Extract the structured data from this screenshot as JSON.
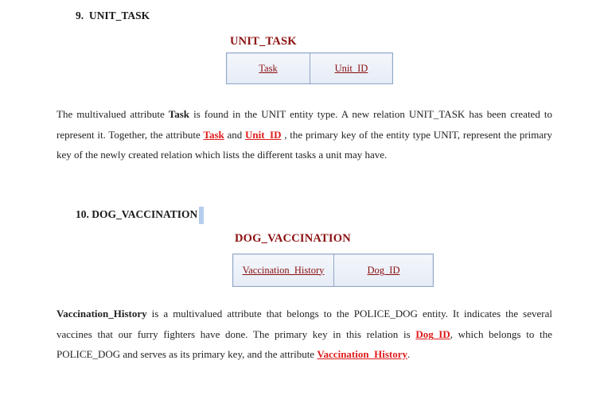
{
  "section9": {
    "heading_number": "9.",
    "heading_text": "UNIT_TASK",
    "relation_title": "UNIT_TASK",
    "attributes": [
      "Task",
      "Unit_ID"
    ],
    "paragraph": {
      "t1": "The multivalued attribute ",
      "b1": "Task",
      "t2": " is found in the UNIT entity type. A new relation UNIT_TASK has been created to represent it. Together, the attribute ",
      "k1": "Task",
      "t3": " and ",
      "k2": "Unit_ID",
      "t4": " , the primary key of the entity type UNIT, represent the primary key of the newly created relation which lists the different tasks a unit may have."
    }
  },
  "section10": {
    "heading_number": "10.",
    "heading_text": "DOG_VACCINATION",
    "relation_title": "DOG_VACCINATION",
    "attributes": [
      "Vaccination_History",
      "Dog_ID"
    ],
    "paragraph": {
      "b1": "Vaccination_History",
      "t1": " is a multivalued attribute that belongs to the POLICE_DOG entity. It indicates the several vaccines that our furry fighters have done. The primary key in this relation is ",
      "k1": "Dog_ID",
      "t2": ", which belongs to the POLICE_DOG and serves as its primary key, and the attribute ",
      "k2": "Vaccination_History",
      "t3": "."
    }
  }
}
